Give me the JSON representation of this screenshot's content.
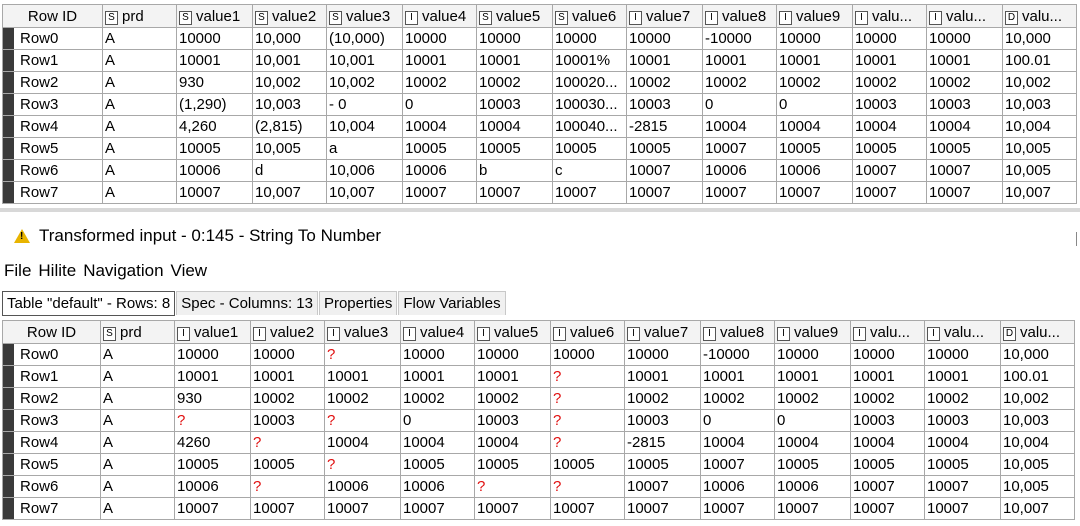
{
  "columns": [
    {
      "label": "Row ID",
      "type": ""
    },
    {
      "label": "prd",
      "type": "S"
    },
    {
      "label": "value1",
      "type": "S"
    },
    {
      "label": "value2",
      "type": "S"
    },
    {
      "label": "value3",
      "type": "S"
    },
    {
      "label": "value4",
      "type": "I"
    },
    {
      "label": "value5",
      "type": "S"
    },
    {
      "label": "value6",
      "type": "S"
    },
    {
      "label": "value7",
      "type": "I"
    },
    {
      "label": "value8",
      "type": "I"
    },
    {
      "label": "value9",
      "type": "I"
    },
    {
      "label": "valu...",
      "type": "I"
    },
    {
      "label": "valu...",
      "type": "I"
    },
    {
      "label": "valu...",
      "type": "D"
    }
  ],
  "top_rows": [
    [
      "Row0",
      "A",
      "10000",
      "10,000",
      "(10,000)",
      "10000",
      "10000",
      "10000",
      "10000",
      "-10000",
      "10000",
      "10000",
      "10000",
      "10,000"
    ],
    [
      "Row1",
      "A",
      "10001",
      "10,001",
      "10,001",
      "10001",
      "10001",
      "10001%",
      "10001",
      "10001",
      "10001",
      "10001",
      "10001",
      "100.01"
    ],
    [
      "Row2",
      "A",
      "930",
      "10,002",
      "10,002",
      "10002",
      "10002",
      "100020...",
      "10002",
      "10002",
      "10002",
      "10002",
      "10002",
      "10,002"
    ],
    [
      "Row3",
      "A",
      "(1,290)",
      "10,003",
      "- 0",
      "0",
      "10003",
      "100030...",
      "10003",
      "0",
      "0",
      "10003",
      "10003",
      "10,003"
    ],
    [
      "Row4",
      "A",
      "4,260",
      "(2,815)",
      "10,004",
      "10004",
      "10004",
      "100040...",
      "-2815",
      "10004",
      "10004",
      "10004",
      "10004",
      "10,004"
    ],
    [
      "Row5",
      "A",
      "10005",
      "10,005",
      "a",
      "10005",
      "10005",
      "10005",
      "10005",
      "10007",
      "10005",
      "10005",
      "10005",
      "10,005"
    ],
    [
      "Row6",
      "A",
      "10006",
      "d",
      "10,006",
      "10006",
      "b",
      "c",
      "10007",
      "10006",
      "10006",
      "10007",
      "10007",
      "10,005"
    ],
    [
      "Row7",
      "A",
      "10007",
      "10,007",
      "10,007",
      "10007",
      "10007",
      "10007",
      "10007",
      "10007",
      "10007",
      "10007",
      "10007",
      "10,007"
    ]
  ],
  "window_title": "Transformed input - 0:145 - String To Number",
  "menu": [
    "File",
    "Hilite",
    "Navigation",
    "View"
  ],
  "tabs": [
    "Table \"default\" - Rows: 8",
    "Spec - Columns: 13",
    "Properties",
    "Flow Variables"
  ],
  "bottom_columns": [
    {
      "label": "Row ID",
      "type": ""
    },
    {
      "label": "prd",
      "type": "S"
    },
    {
      "label": "value1",
      "type": "I"
    },
    {
      "label": "value2",
      "type": "I"
    },
    {
      "label": "value3",
      "type": "I"
    },
    {
      "label": "value4",
      "type": "I"
    },
    {
      "label": "value5",
      "type": "I"
    },
    {
      "label": "value6",
      "type": "I"
    },
    {
      "label": "value7",
      "type": "I"
    },
    {
      "label": "value8",
      "type": "I"
    },
    {
      "label": "value9",
      "type": "I"
    },
    {
      "label": "valu...",
      "type": "I"
    },
    {
      "label": "valu...",
      "type": "I"
    },
    {
      "label": "valu...",
      "type": "D"
    }
  ],
  "bottom_rows": [
    [
      "Row0",
      "A",
      "10000",
      "10000",
      "?",
      "10000",
      "10000",
      "10000",
      "10000",
      "-10000",
      "10000",
      "10000",
      "10000",
      "10,000"
    ],
    [
      "Row1",
      "A",
      "10001",
      "10001",
      "10001",
      "10001",
      "10001",
      "?",
      "10001",
      "10001",
      "10001",
      "10001",
      "10001",
      "100.01"
    ],
    [
      "Row2",
      "A",
      "930",
      "10002",
      "10002",
      "10002",
      "10002",
      "?",
      "10002",
      "10002",
      "10002",
      "10002",
      "10002",
      "10,002"
    ],
    [
      "Row3",
      "A",
      "?",
      "10003",
      "?",
      "0",
      "10003",
      "?",
      "10003",
      "0",
      "0",
      "10003",
      "10003",
      "10,003"
    ],
    [
      "Row4",
      "A",
      "4260",
      "?",
      "10004",
      "10004",
      "10004",
      "?",
      "-2815",
      "10004",
      "10004",
      "10004",
      "10004",
      "10,004"
    ],
    [
      "Row5",
      "A",
      "10005",
      "10005",
      "?",
      "10005",
      "10005",
      "10005",
      "10005",
      "10007",
      "10005",
      "10005",
      "10005",
      "10,005"
    ],
    [
      "Row6",
      "A",
      "10006",
      "?",
      "10006",
      "10006",
      "?",
      "?",
      "10007",
      "10006",
      "10006",
      "10007",
      "10007",
      "10,005"
    ],
    [
      "Row7",
      "A",
      "10007",
      "10007",
      "10007",
      "10007",
      "10007",
      "10007",
      "10007",
      "10007",
      "10007",
      "10007",
      "10007",
      "10,007"
    ]
  ],
  "colors": {
    "missing": "#e01010",
    "row_marker": "#3a3a3a",
    "warning": "#e8b400"
  }
}
